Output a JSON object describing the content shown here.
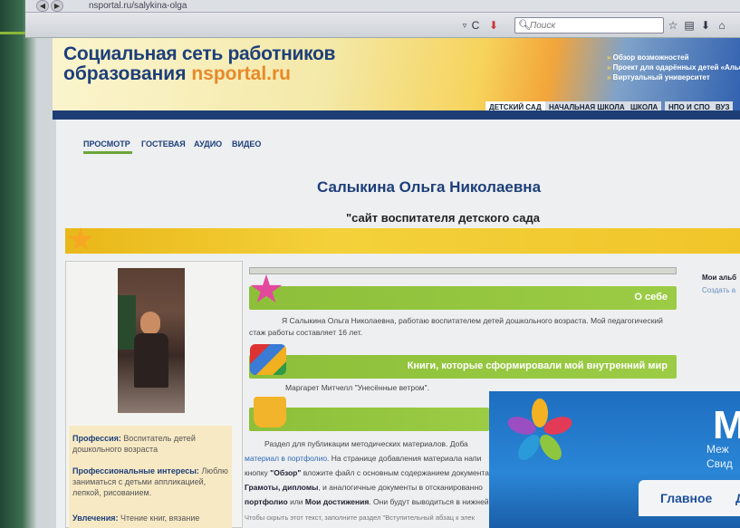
{
  "browser": {
    "url": "nsportal.ru/salykina-olga",
    "search_placeholder": "Поиск",
    "back_label": "◀",
    "forward_label": "▶",
    "reload_label": "C"
  },
  "site": {
    "logo_line1": "Социальная сеть работников",
    "logo_line2_prefix": "образования ",
    "logo_brand": "nsportal.ru",
    "header_links": [
      "Обзор возможностей",
      "Проект для одарённых детей «Альф",
      "Виртуальный университет"
    ],
    "nav_tabs": [
      "ДЕТСКИЙ САД",
      "НАЧАЛЬНАЯ ШКОЛА",
      "ШКОЛА",
      "НПО И СПО",
      "ВУЗ"
    ]
  },
  "page": {
    "tabs": [
      "ПРОСМОТР",
      "ГОСТЕВАЯ",
      "АУДИО",
      "ВИДЕО"
    ],
    "name": "Салыкина Ольга Николаевна",
    "subtitle": "\"сайт воспитателя детского сада"
  },
  "profile": {
    "profession_label": "Профессия:",
    "profession_value": "Воспитатель детей дошкольного возраста",
    "interests_label": "Профессиональные интересы:",
    "interests_value": "Люблю заниматься с детьми аппликацией, лепкой, рисованием.",
    "hobbies_label": "Увлечения:",
    "hobbies_value": "Чтение книг, вязание"
  },
  "sections": {
    "about_title": "О себе",
    "about_text": "Я Салыкина Ольга Николаевна, работаю воспитателем детей дошкольного возраста. Мой педагогический стаж работы составляет 16 лет.",
    "books_title": "Книги, которые сформировали мой внутренний мир",
    "books_text": "Маргарет Митчелл \"Унесённые ветром\".",
    "pub_text_1": "Раздел для публикации методических материалов. Доба",
    "pub_link": "материал в портфолио",
    "pub_text_2": ". На странице добавления материала напи",
    "pub_text_3": "кнопку ",
    "pub_obzor": "\"Обзор\"",
    "pub_text_4": " вложите файл с основным содержанием документа",
    "pub_text_5": "Грамоты, дипломы",
    "pub_text_6": ", и аналогичные документы в отсканированно",
    "pub_text_7": "портфолио",
    "pub_text_8": " или ",
    "pub_text_9": "Мои достижения",
    "pub_text_10": ". Они будут выводиться в нижней ч",
    "pub_text_11": "Чтобы скрыть этот текст, заполните раздел \"Вступительный абзац к элек"
  },
  "right_edge": {
    "title": "Мои альб",
    "link": "Создать а"
  },
  "overlay": {
    "big_letter": "М",
    "sub_line1": "Меж",
    "sub_line2": "Свид",
    "nav_main": "Главное",
    "nav_next": "Д"
  },
  "colors": {
    "brand_blue": "#1d3f7a",
    "accent_orange": "#e8892a",
    "green_bar": "#9ccc45",
    "yellow_band": "#f4d13a"
  }
}
